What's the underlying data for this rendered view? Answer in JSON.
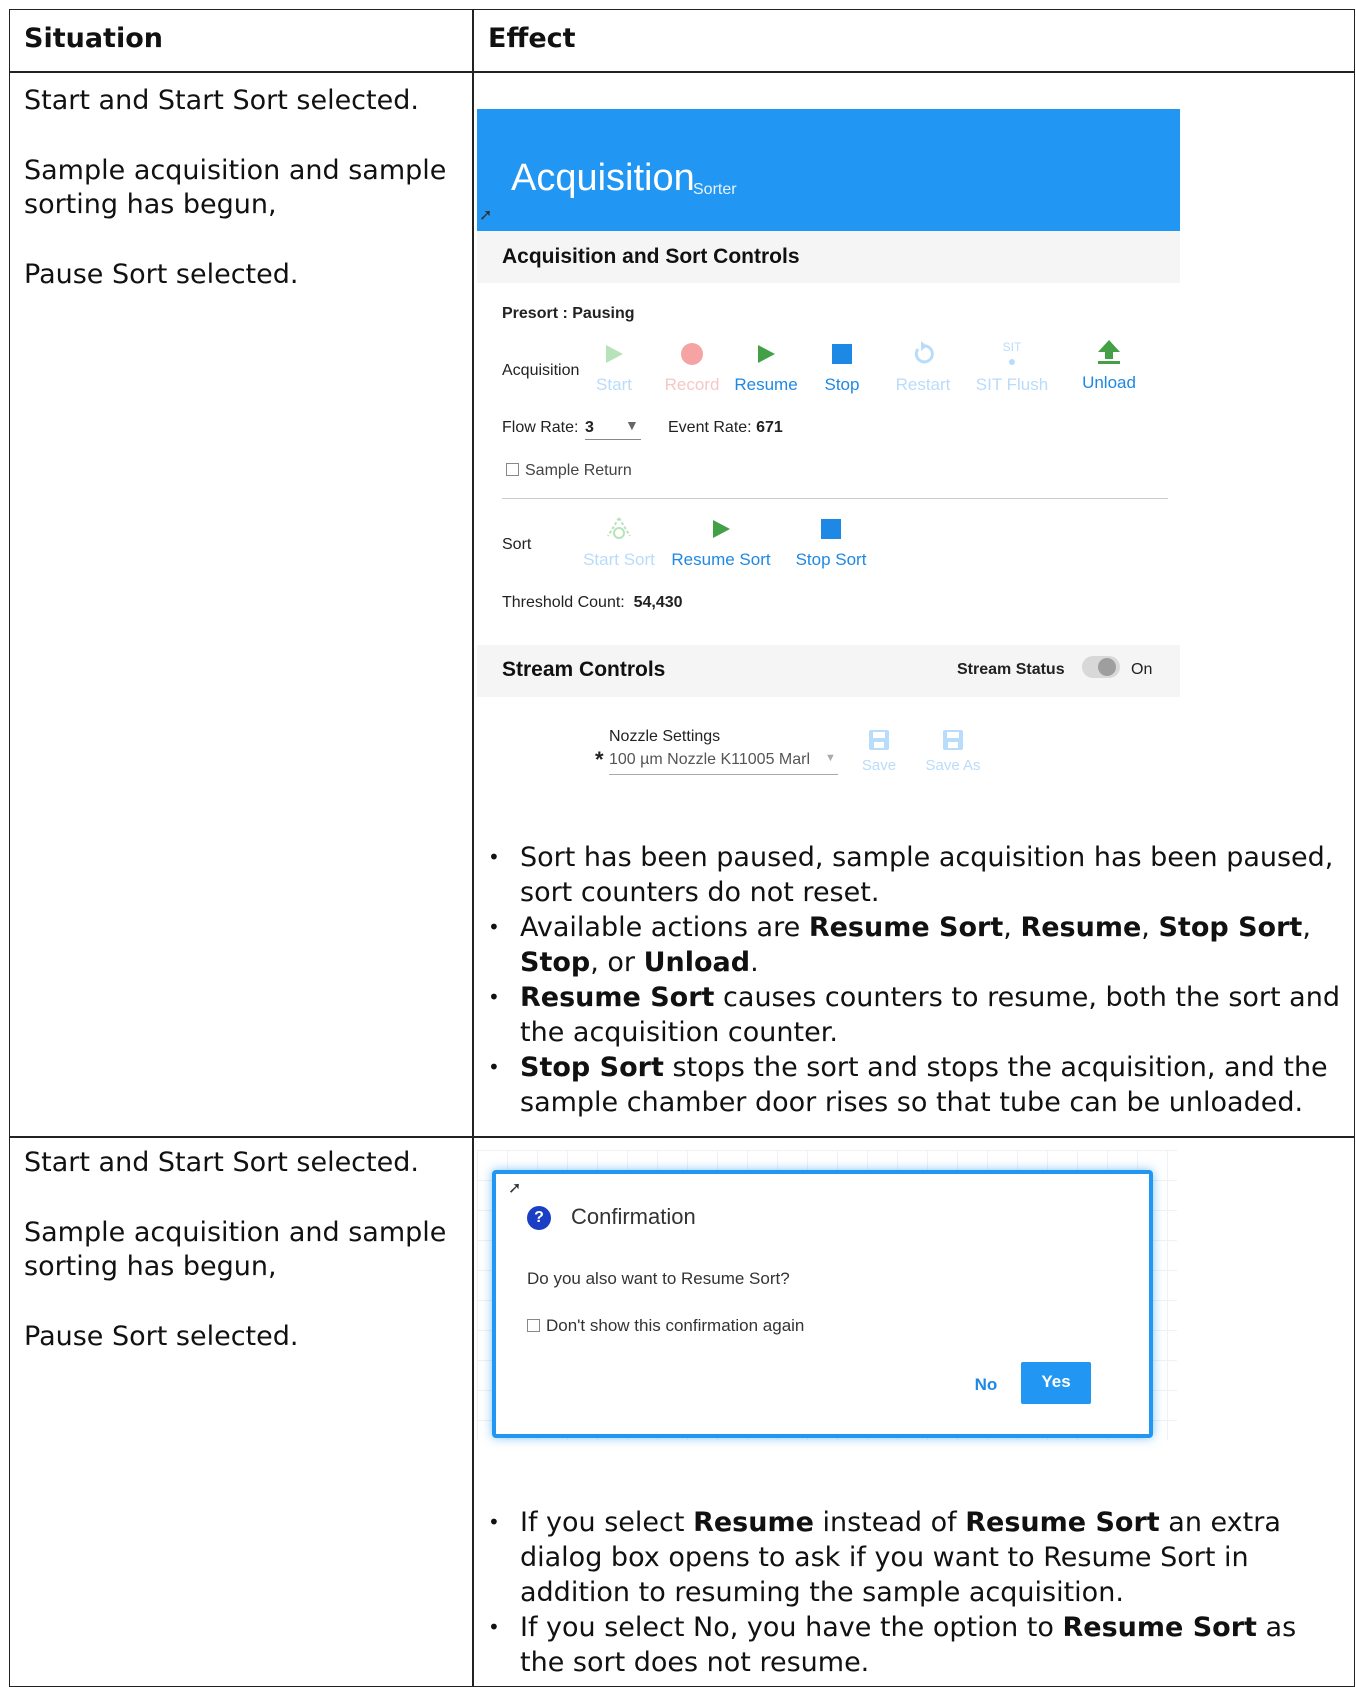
{
  "table": {
    "headers": [
      "Situation",
      "Effect"
    ],
    "rows": [
      {
        "situation": [
          "Start and Start Sort selected.",
          "Sample acquisition and sample sorting has begun,",
          "Pause Sort selected."
        ],
        "bullets": [
          [
            {
              "t": "Sort has been paused, sample acquisition has been paused, sort counters do not reset."
            }
          ],
          [
            {
              "t": "Available actions are "
            },
            {
              "b": "Resume Sort"
            },
            {
              "t": ", "
            },
            {
              "b": "Resume"
            },
            {
              "t": ", "
            },
            {
              "b": "Stop Sort"
            },
            {
              "t": ", "
            },
            {
              "b": "Stop"
            },
            {
              "t": ", or "
            },
            {
              "b": "Unload"
            },
            {
              "t": "."
            }
          ],
          [
            {
              "b": "Resume Sort"
            },
            {
              "t": " causes counters to resume, both the sort and the acquisition counter."
            }
          ],
          [
            {
              "b": "Stop Sort"
            },
            {
              "t": " stops the sort and stops the acquisition, and the sample chamber door rises so that tube can be unloaded."
            }
          ]
        ]
      },
      {
        "situation": [
          "Start and Start Sort selected.",
          "Sample acquisition and sample sorting has begun,",
          "Pause Sort selected."
        ],
        "bullets": [
          [
            {
              "t": "If you select "
            },
            {
              "b": "Resume"
            },
            {
              "t": " instead of "
            },
            {
              "b": "Resume Sort"
            },
            {
              "t": " an extra dialog box opens to ask if you want to Resume Sort in addition to resuming the sample acquisition."
            }
          ],
          [
            {
              "t": "If you select No, you have the option to "
            },
            {
              "b": "Resume Sort"
            },
            {
              "t": " as the sort does not resume."
            }
          ]
        ]
      }
    ]
  },
  "acquisition_panel": {
    "title": "Acquisition",
    "subtitle": "Sorter",
    "section_title": "Acquisition and Sort Controls",
    "presort_label": "Presort :",
    "presort_value": "Pausing",
    "acquisition_label": "Acquisition",
    "buttons": {
      "start": "Start",
      "record": "Record",
      "resume": "Resume",
      "stop": "Stop",
      "restart": "Restart",
      "sit_flush": "SIT Flush",
      "sit_icon_text": "SIT",
      "unload": "Unload"
    },
    "flow_rate_label": "Flow Rate:",
    "flow_rate_value": "3",
    "event_rate_label": "Event Rate:",
    "event_rate_value": "671",
    "sample_return_label": "Sample Return",
    "sort_label": "Sort",
    "sort_buttons": {
      "start_sort": "Start Sort",
      "resume_sort": "Resume Sort",
      "stop_sort": "Stop Sort"
    },
    "threshold_label": "Threshold Count:",
    "threshold_value": "54,430",
    "stream_title": "Stream Controls",
    "stream_status_label": "Stream Status",
    "stream_status_value": "On",
    "nozzle_label": "Nozzle Settings",
    "nozzle_required": "*",
    "nozzle_value": "100 µm Nozzle K11005 Marl",
    "save": "Save",
    "save_as": "Save As",
    "colors": {
      "header": "#2196f3",
      "play_green": "#43a047",
      "stop_blue": "#1e88e5",
      "record_red": "#f5a3a3"
    }
  },
  "confirmation_dialog": {
    "title": "Confirmation",
    "icon": "question-icon",
    "message": "Do you also want to Resume Sort?",
    "checkbox_label": "Don't show this confirmation again",
    "no": "No",
    "yes": "Yes"
  }
}
